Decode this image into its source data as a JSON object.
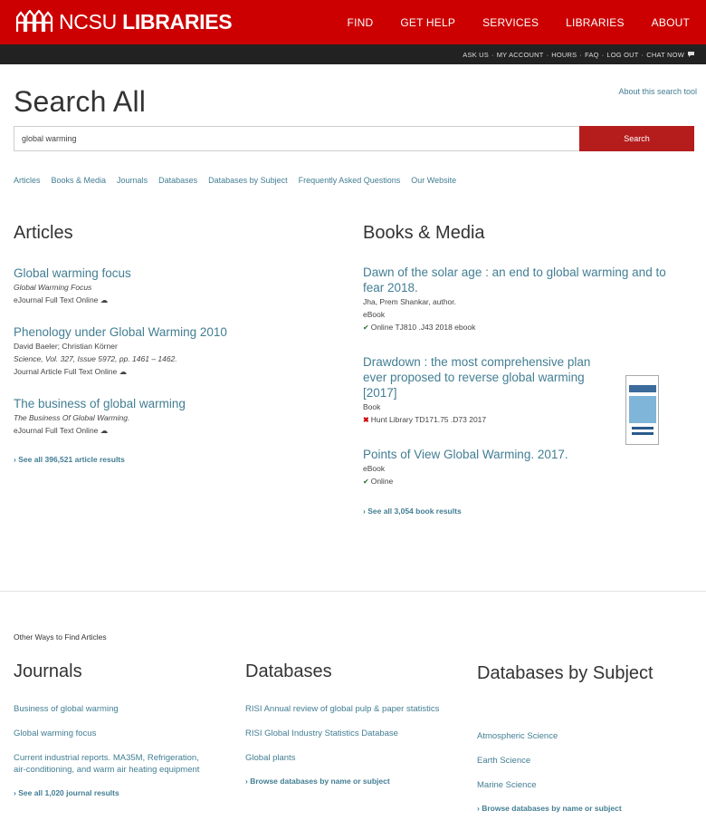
{
  "header": {
    "logo_light": "NCSU",
    "logo_bold": "LIBRARIES",
    "nav": [
      "FIND",
      "GET HELP",
      "SERVICES",
      "LIBRARIES",
      "ABOUT"
    ],
    "util_links": [
      "ASK US",
      "MY ACCOUNT",
      "HOURS",
      "FAQ",
      "LOG OUT",
      "CHAT NOW"
    ]
  },
  "search": {
    "title": "Search All",
    "about_link": "About this search tool",
    "query": "global warming",
    "button_label": "Search"
  },
  "tabs": [
    "Articles",
    "Books & Media",
    "Journals",
    "Databases",
    "Databases by Subject",
    "Frequently Asked Questions",
    "Our Website"
  ],
  "articles": {
    "heading": "Articles",
    "items": [
      {
        "title": "Global warming focus",
        "source": "Global Warming Focus",
        "access": "eJournal Full Text Online"
      },
      {
        "title": "Phenology under Global Warming 2010",
        "authors": "David Baeler; Christian Körner",
        "source": "Science, Vol. 327, Issue 5972, pp. 1461 – 1462.",
        "access": "Journal Article Full Text Online"
      },
      {
        "title": "The business of global warming",
        "source": "The Business Of Global Warming.",
        "access": "eJournal Full Text Online"
      }
    ],
    "see_all": "See all 396,521 article results"
  },
  "books": {
    "heading": "Books & Media",
    "items": [
      {
        "title": "Dawn of the solar age : an end to global warming and to fear 2018.",
        "author": "Jha, Prem Shankar, author.",
        "format": "eBook",
        "availability": "Online TJ810 .J43 2018 ebook",
        "status": "available"
      },
      {
        "title": "Drawdown : the most comprehensive plan ever proposed to reverse global warming [2017]",
        "format": "Book",
        "availability": "Hunt Library TD171.75 .D73 2017",
        "status": "unavailable"
      },
      {
        "title": "Points of View Global Warming. 2017.",
        "format": "eBook",
        "availability": "Online",
        "status": "available"
      }
    ],
    "see_all": "See all 3,054 book results"
  },
  "other_ways": "Other Ways to Find Articles",
  "journals": {
    "heading": "Journals",
    "items": [
      "Business of global warming",
      "Global warming focus",
      "Current industrial reports. MA35M, Refrigeration, air-conditioning, and warm air heating equipment"
    ],
    "see_all": "See all 1,020 journal results"
  },
  "databases": {
    "heading": "Databases",
    "items": [
      "RISI Annual review of global pulp & paper statistics",
      "RISI Global Industry Statistics Database",
      "Global plants"
    ],
    "see_all": "Browse databases by name or subject"
  },
  "databases_by_subject": {
    "heading": "Databases by Subject",
    "items": [
      "Atmospheric Science",
      "Earth Science",
      "Marine Science"
    ],
    "see_all": "Browse databases by name or subject"
  },
  "colors": {
    "header_red": "#cc0000",
    "util_bar": "#222222",
    "link": "#427e93",
    "search_button": "#b51d1d"
  }
}
